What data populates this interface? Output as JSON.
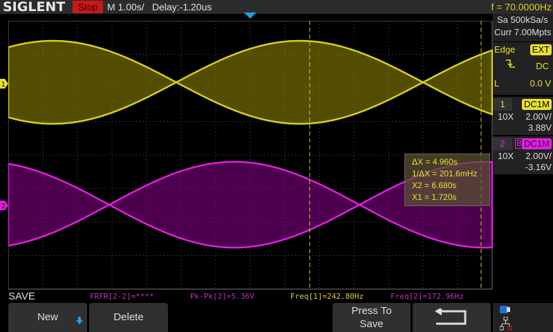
{
  "header": {
    "logo": "SIGLENT",
    "run_state": "Stop",
    "timebase": "M 1.00s/",
    "delay": "Delay:-1.20us",
    "trigger_freq": "f = 70.0000Hz"
  },
  "acquisition": {
    "sample_rate": "Sa 500kSa/s",
    "memory_depth": "Curr 7.00Mpts"
  },
  "trigger": {
    "type": "Edge",
    "source": "EXT",
    "slope_icon": "falling-edge-icon",
    "coupling": "DC",
    "level_label": "L",
    "level": "0.0 V"
  },
  "channels": [
    {
      "num": "1",
      "coupling": "DC1M",
      "probe": "10X",
      "scale": "2.00V/",
      "offset": "3.88V",
      "color": "#e8e030",
      "bandwidth_limit": ""
    },
    {
      "num": "2",
      "coupling": "DC1M",
      "probe": "10X",
      "scale": "2.00V/",
      "offset": "-3.16V",
      "color": "#e020e0",
      "bandwidth_limit": "B"
    }
  ],
  "cursors": {
    "dx": "ΔX = 4.960s",
    "inv_dx": "1/ΔX = 201.6mHz",
    "x2": "X2 = 6.680s",
    "x1": "X1 = 1.720s"
  },
  "measurements": [
    {
      "text": "FRFR[2-2]=****",
      "color": "#c030c0"
    },
    {
      "text": "Pk-Pk[2]=5.36V",
      "color": "#c030c0"
    },
    {
      "text": "Freq[1]=242.80Hz",
      "color": "#d8d040"
    },
    {
      "text": "Freq[2]=172.96Hz",
      "color": "#c030c0"
    }
  ],
  "menu": {
    "title": "SAVE",
    "new_label": "New",
    "delete_label": "Delete",
    "press_to_save_line1": "Press To",
    "press_to_save_line2": "Save",
    "back_icon": "return-arrow-icon"
  },
  "status_icons": [
    "usb-icon",
    "network-icon"
  ]
}
